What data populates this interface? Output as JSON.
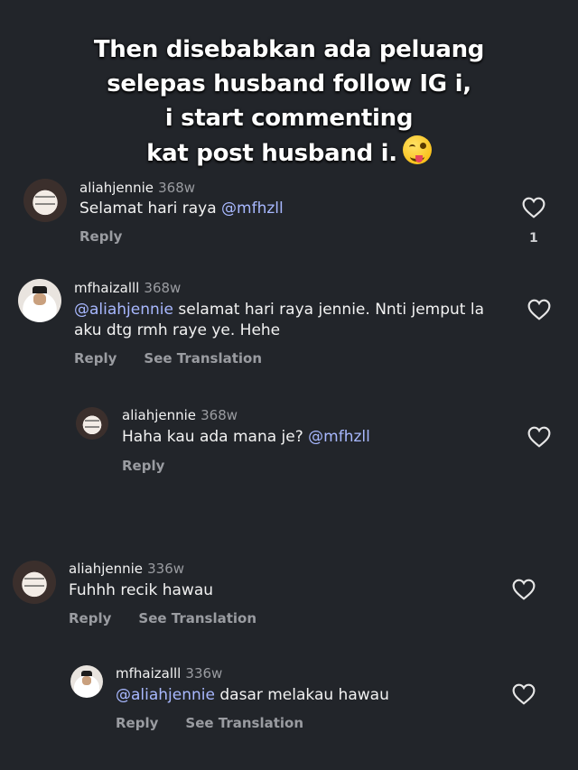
{
  "caption": {
    "line1": "Then disebabkan ada peluang",
    "line2": "selepas husband follow IG i,",
    "line3": "i start commenting",
    "line4": "kat post husband i.",
    "emoji": "winking-face-with-tongue"
  },
  "comments": [
    {
      "username": "aliahjennie",
      "time": "368w",
      "mention": "@mfhzll",
      "text_before": "Selamat hari raya ",
      "reply": "Reply",
      "likes": "1"
    },
    {
      "username": "mfhaizalll",
      "time": "368w",
      "mention": "@aliahjennie",
      "text_after": " selamat hari raya jennie. Nnti jemput la",
      "text_line2": "aku dtg rmh raye ye. Hehe",
      "reply": "Reply",
      "translate": "See Translation"
    },
    {
      "username": "aliahjennie",
      "time": "368w",
      "text_before": "Haha kau ada mana je? ",
      "mention": "@mfhzll",
      "reply": "Reply"
    },
    {
      "username": "aliahjennie",
      "time": "336w",
      "text": "Fuhhh recik hawau",
      "reply": "Reply",
      "translate": "See Translation"
    },
    {
      "username": "mfhaizalll",
      "time": "336w",
      "mention": "@aliahjennie",
      "text_after": " dasar melakau hawau",
      "reply": "Reply",
      "translate": "See Translation"
    }
  ],
  "colors": {
    "background": "#22252a",
    "mention": "#a8b8ff",
    "secondary_text": "#9a9ca1"
  }
}
